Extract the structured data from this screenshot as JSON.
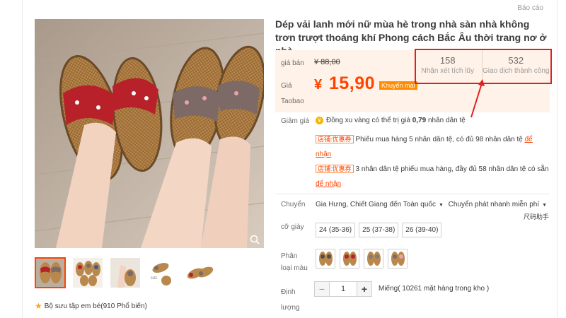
{
  "report_link": "Báo cáo",
  "product": {
    "title": "Dép vải lanh mới nữ mùa hè trong nhà sàn nhà không trơn trượt thoáng khí Phong cách Bắc Âu thời trang nơ ở nhà"
  },
  "price": {
    "orig_label": "giá bán",
    "orig_value": "¥ 88,00",
    "taobao_label": "Giá Taobao",
    "currency": "¥",
    "sale_value": "15,90",
    "promo_tag": "Khuyến mại"
  },
  "stats": [
    {
      "value": "158",
      "label": "Nhận xét tích lũy"
    },
    {
      "value": "532",
      "label": "Giao dịch thành công"
    }
  ],
  "discount": {
    "label": "Giảm giá",
    "coin_text_pre": "Đồng xu vàng có thể trị giá ",
    "coin_value": "0,79",
    "coin_text_post": " nhân dân tệ",
    "coupon_tag": "店铺:优惠券",
    "coupon1_text": "Phiếu mua hàng 5 nhân dân tệ, có đủ 98 nhân dân tệ",
    "coupon1_link": "để nhận",
    "coupon2_text": "3 nhân dân tệ phiếu mua hàng, đầy đủ 58 nhân dân tệ có sẵn",
    "coupon2_link": "để nhận"
  },
  "shipping": {
    "label": "Chuyển",
    "route": "Gia Hưng, Chiết Giang đến Toàn quốc",
    "method": "Chuyển phát nhanh miễn phí"
  },
  "size_chart_link": "尺码助手",
  "size": {
    "label": "cỡ giày",
    "options": [
      "24 (35-36)",
      "25 (37-38)",
      "26 (39-40)"
    ]
  },
  "color": {
    "label": "Phân loại màu"
  },
  "quantity": {
    "label": "Định lượng",
    "value": "1",
    "minus": "−",
    "plus": "+",
    "stock": "Miếng( 10261 mặt hàng trong kho )"
  },
  "favorite": {
    "text": "Bộ sưu tập em bé(910 Phổ biến)"
  },
  "colors": {
    "accent": "#ff4400",
    "promo": "#ff8c00",
    "price_bg": "#fff2e8",
    "highlight": "#e02020"
  }
}
